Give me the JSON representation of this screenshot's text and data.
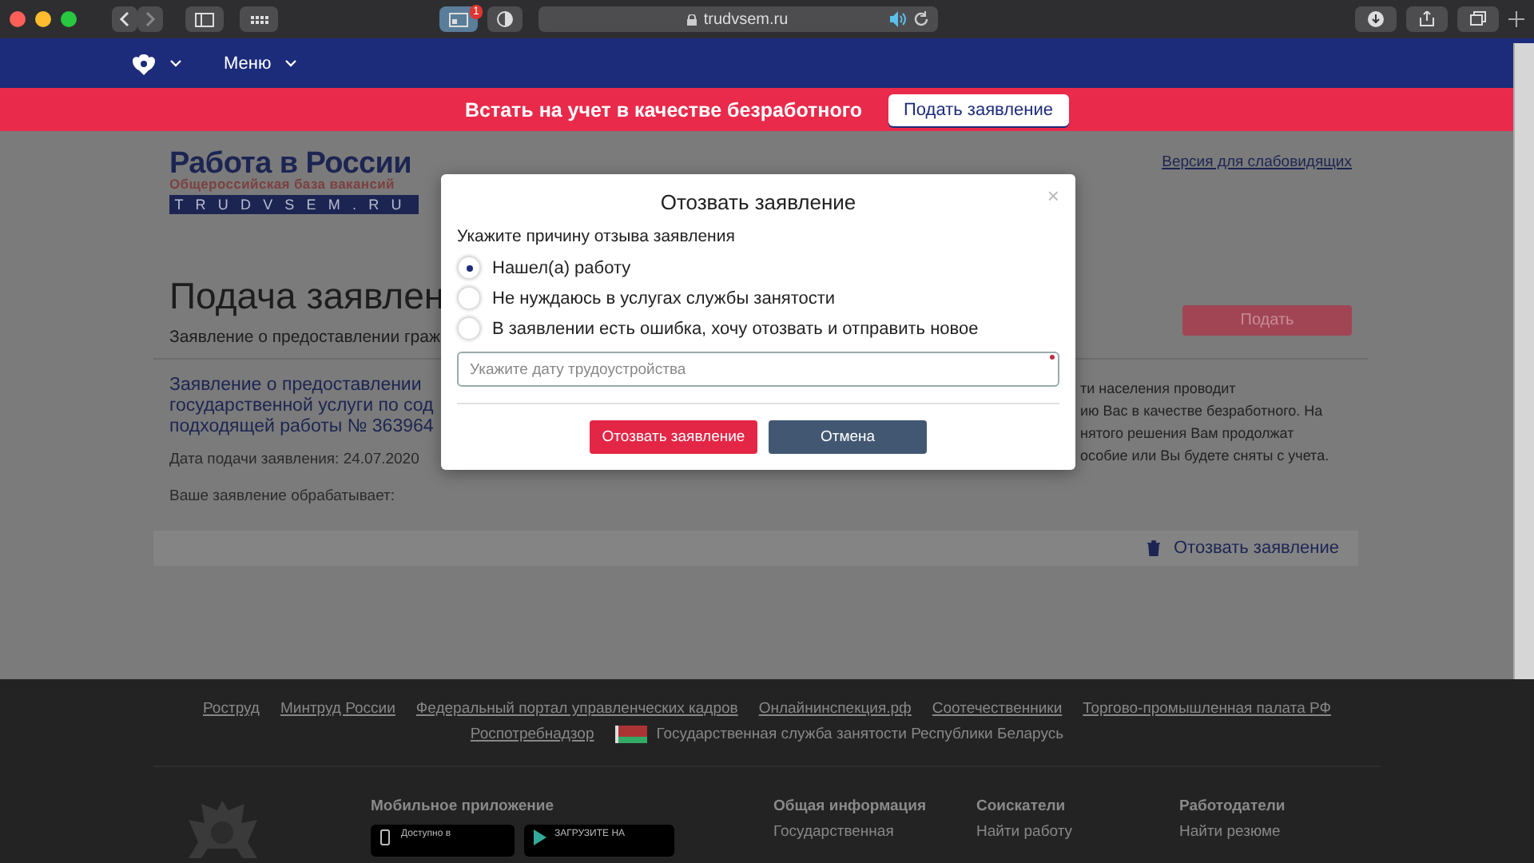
{
  "browser": {
    "address": "trudvsem.ru",
    "tab_badge": "1"
  },
  "header": {
    "menu": "Меню"
  },
  "banner": {
    "text": "Встать на учет в качестве безработного",
    "button": "Подать заявление"
  },
  "logo": {
    "title": "Работа в России",
    "subtitle": "Общероссийская база вакансий",
    "domain": "TRUDVSEM.RU"
  },
  "accessibility_link": "Версия для слабовидящих",
  "page": {
    "title": "Подача заявлен",
    "subtitle": "Заявление о предоставлении граж",
    "submit_button": "Подать",
    "application": {
      "title": "Заявление о предоставлении\nгосударственной услуги по сод\nподходящей работы № 363964",
      "date": "Дата подачи заявления: 24.07.2020",
      "processor": "Ваше заявление обрабатывает:",
      "info": "ти населения проводит\nию Вас в качестве безработного. На\nнятого решения Вам продолжат\nособие или Вы будете сняты с учета."
    },
    "withdraw_link": "Отозвать заявление"
  },
  "modal": {
    "title": "Отозвать заявление",
    "close": "×",
    "prompt": "Укажите причину отзыва заявления",
    "reasons": [
      {
        "label": "Нашел(а) работу",
        "selected": true
      },
      {
        "label": "Не нуждаюсь в услугах службы занятости",
        "selected": false
      },
      {
        "label": "В заявлении есть ошибка, хочу отозвать и отправить новое",
        "selected": false
      }
    ],
    "date_field": {
      "placeholder": "Укажите дату трудоустройства",
      "required": true
    },
    "buttons": [
      {
        "label": "Отозвать заявление",
        "kind": "primary"
      },
      {
        "label": "Отмена",
        "kind": "secondary"
      }
    ]
  },
  "footer": {
    "links": [
      {
        "label": "Роструд"
      },
      {
        "label": "Минтруд России"
      },
      {
        "label": "Федеральный портал управленческих кадров"
      },
      {
        "label": "Онлайнинспекция.рф"
      },
      {
        "label": "Соотечественники"
      },
      {
        "label": "Торгово-промышленная палата РФ"
      }
    ],
    "links_row2": [
      {
        "label": "Роспотребнадзор",
        "kind": "text"
      },
      {
        "label": "Государственная служба занятости Республики Беларусь",
        "kind": "flag"
      }
    ],
    "mobile": {
      "title": "Мобильное приложение",
      "badges": [
        "Доступно в",
        "ЗАГРУЗИТЕ НА"
      ]
    },
    "columns": [
      {
        "title": "Общая информация",
        "items": [
          "Государственная"
        ]
      },
      {
        "title": "Соискатели",
        "items": [
          "Найти работу"
        ]
      },
      {
        "title": "Работодатели",
        "items": [
          "Найти резюме"
        ]
      }
    ]
  }
}
